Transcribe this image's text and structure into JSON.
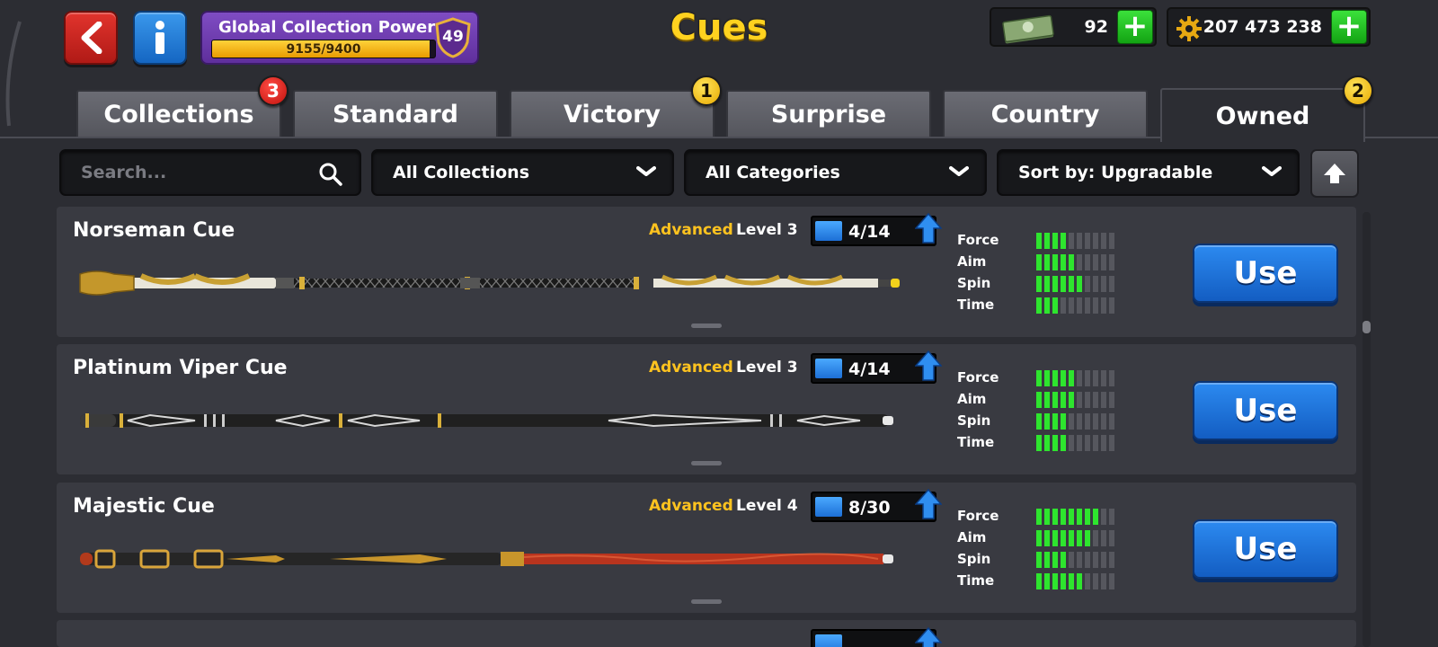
{
  "header": {
    "title": "Cues",
    "global_collection_power": {
      "label": "Global Collection Power",
      "progress_text": "9155/9400",
      "progress_fraction": 0.974,
      "level": "49"
    },
    "cash": {
      "value": "92",
      "icon": "cash-icon"
    },
    "coins": {
      "value": "207 473 238",
      "icon": "coins-icon"
    }
  },
  "tabs": [
    {
      "label": "Collections",
      "badge": "3",
      "badge_color": "#d9231c"
    },
    {
      "label": "Standard"
    },
    {
      "label": "Victory",
      "badge": "1",
      "badge_color": "#f2c200"
    },
    {
      "label": "Surprise"
    },
    {
      "label": "Country"
    },
    {
      "label": "Owned",
      "badge": "2",
      "badge_color": "#f2c200",
      "active": true
    }
  ],
  "filters": {
    "search_placeholder": "Search...",
    "collections": "All Collections",
    "categories": "All Categories",
    "sort": "Sort by: Upgradable"
  },
  "stat_labels": {
    "force": "Force",
    "aim": "Aim",
    "spin": "Spin",
    "time": "Time"
  },
  "cues": [
    {
      "name": "Norseman Cue",
      "tier": "Advanced",
      "level": "Level 3",
      "progress": "4/14",
      "use_label": "Use",
      "stats": {
        "force": 4,
        "aim": 5,
        "spin": 6,
        "time": 3
      }
    },
    {
      "name": "Platinum Viper Cue",
      "tier": "Advanced",
      "level": "Level 3",
      "progress": "4/14",
      "use_label": "Use",
      "stats": {
        "force": 5,
        "aim": 5,
        "spin": 4,
        "time": 4
      }
    },
    {
      "name": "Majestic Cue",
      "tier": "Advanced",
      "level": "Level 4",
      "progress": "8/30",
      "use_label": "Use",
      "stats": {
        "force": 8,
        "aim": 7,
        "spin": 4,
        "time": 6
      }
    }
  ],
  "colors": {
    "accent_yellow": "#ffd21f",
    "tier_yellow": "#ffc31f",
    "use_blue": "#1f75dc",
    "stat_green": "#2ee52e",
    "plus_green": "#22c222"
  }
}
